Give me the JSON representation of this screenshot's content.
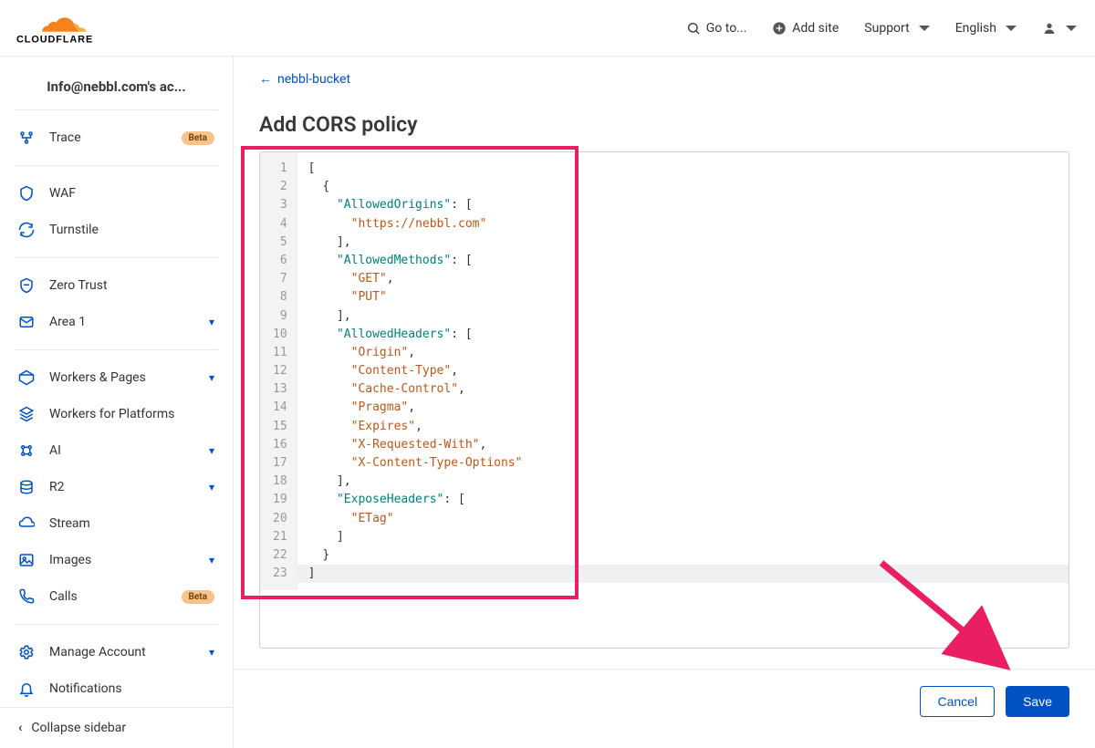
{
  "header": {
    "goto": "Go to...",
    "add_site": "Add site",
    "support": "Support",
    "language": "English"
  },
  "sidebar": {
    "account": "Info@nebbl.com's ac...",
    "items": [
      {
        "icon": "trace",
        "label": "Trace",
        "badge": "Beta",
        "expand": false
      },
      {
        "divider": true
      },
      {
        "icon": "waf",
        "label": "WAF",
        "expand": false
      },
      {
        "icon": "turnstile",
        "label": "Turnstile",
        "expand": false
      },
      {
        "divider": true
      },
      {
        "icon": "zero-trust",
        "label": "Zero Trust",
        "expand": false
      },
      {
        "icon": "area1",
        "label": "Area 1",
        "expand": true
      },
      {
        "divider": true
      },
      {
        "icon": "workers",
        "label": "Workers & Pages",
        "expand": true
      },
      {
        "icon": "wfp",
        "label": "Workers for Platforms",
        "expand": false
      },
      {
        "icon": "ai",
        "label": "AI",
        "expand": true
      },
      {
        "icon": "r2",
        "label": "R2",
        "expand": true
      },
      {
        "icon": "stream",
        "label": "Stream",
        "expand": false
      },
      {
        "icon": "images",
        "label": "Images",
        "expand": true
      },
      {
        "icon": "calls",
        "label": "Calls",
        "badge": "Beta",
        "expand": false
      },
      {
        "divider": true
      },
      {
        "icon": "manage",
        "label": "Manage Account",
        "expand": true
      },
      {
        "icon": "notifications",
        "label": "Notifications",
        "expand": false
      }
    ],
    "collapse": "Collapse sidebar"
  },
  "main": {
    "breadcrumb": "nebbl-bucket",
    "title": "Add CORS policy",
    "code_lines": [
      {
        "tokens": [
          {
            "t": "[",
            "c": "punc"
          }
        ]
      },
      {
        "tokens": [
          {
            "t": "  ",
            "c": ""
          },
          {
            "t": "{",
            "c": "punc"
          }
        ]
      },
      {
        "tokens": [
          {
            "t": "    ",
            "c": ""
          },
          {
            "t": "\"AllowedOrigins\"",
            "c": "key"
          },
          {
            "t": ": [",
            "c": "punc"
          }
        ]
      },
      {
        "tokens": [
          {
            "t": "      ",
            "c": ""
          },
          {
            "t": "\"https://nebbl.com\"",
            "c": "str"
          }
        ]
      },
      {
        "tokens": [
          {
            "t": "    ",
            "c": ""
          },
          {
            "t": "],",
            "c": "punc"
          }
        ]
      },
      {
        "tokens": [
          {
            "t": "    ",
            "c": ""
          },
          {
            "t": "\"AllowedMethods\"",
            "c": "key"
          },
          {
            "t": ": [",
            "c": "punc"
          }
        ]
      },
      {
        "tokens": [
          {
            "t": "      ",
            "c": ""
          },
          {
            "t": "\"GET\"",
            "c": "str"
          },
          {
            "t": ",",
            "c": "punc"
          }
        ]
      },
      {
        "tokens": [
          {
            "t": "      ",
            "c": ""
          },
          {
            "t": "\"PUT\"",
            "c": "str"
          }
        ]
      },
      {
        "tokens": [
          {
            "t": "    ",
            "c": ""
          },
          {
            "t": "],",
            "c": "punc"
          }
        ]
      },
      {
        "tokens": [
          {
            "t": "    ",
            "c": ""
          },
          {
            "t": "\"AllowedHeaders\"",
            "c": "key"
          },
          {
            "t": ": [",
            "c": "punc"
          }
        ]
      },
      {
        "tokens": [
          {
            "t": "      ",
            "c": ""
          },
          {
            "t": "\"Origin\"",
            "c": "str"
          },
          {
            "t": ",",
            "c": "punc"
          }
        ]
      },
      {
        "tokens": [
          {
            "t": "      ",
            "c": ""
          },
          {
            "t": "\"Content-Type\"",
            "c": "str"
          },
          {
            "t": ",",
            "c": "punc"
          }
        ]
      },
      {
        "tokens": [
          {
            "t": "      ",
            "c": ""
          },
          {
            "t": "\"Cache-Control\"",
            "c": "str"
          },
          {
            "t": ",",
            "c": "punc"
          }
        ]
      },
      {
        "tokens": [
          {
            "t": "      ",
            "c": ""
          },
          {
            "t": "\"Pragma\"",
            "c": "str"
          },
          {
            "t": ",",
            "c": "punc"
          }
        ]
      },
      {
        "tokens": [
          {
            "t": "      ",
            "c": ""
          },
          {
            "t": "\"Expires\"",
            "c": "str"
          },
          {
            "t": ",",
            "c": "punc"
          }
        ]
      },
      {
        "tokens": [
          {
            "t": "      ",
            "c": ""
          },
          {
            "t": "\"X-Requested-With\"",
            "c": "str"
          },
          {
            "t": ",",
            "c": "punc"
          }
        ]
      },
      {
        "tokens": [
          {
            "t": "      ",
            "c": ""
          },
          {
            "t": "\"X-Content-Type-Options\"",
            "c": "str"
          }
        ]
      },
      {
        "tokens": [
          {
            "t": "    ",
            "c": ""
          },
          {
            "t": "],",
            "c": "punc"
          }
        ]
      },
      {
        "tokens": [
          {
            "t": "    ",
            "c": ""
          },
          {
            "t": "\"ExposeHeaders\"",
            "c": "key"
          },
          {
            "t": ": [",
            "c": "punc"
          }
        ]
      },
      {
        "tokens": [
          {
            "t": "      ",
            "c": ""
          },
          {
            "t": "\"ETag\"",
            "c": "str"
          }
        ]
      },
      {
        "tokens": [
          {
            "t": "    ",
            "c": ""
          },
          {
            "t": "]",
            "c": "punc"
          }
        ]
      },
      {
        "tokens": [
          {
            "t": "  ",
            "c": ""
          },
          {
            "t": "}",
            "c": "punc"
          }
        ]
      },
      {
        "tokens": [
          {
            "t": "]",
            "c": "punc"
          }
        ],
        "hl": true
      }
    ],
    "cancel": "Cancel",
    "save": "Save"
  }
}
